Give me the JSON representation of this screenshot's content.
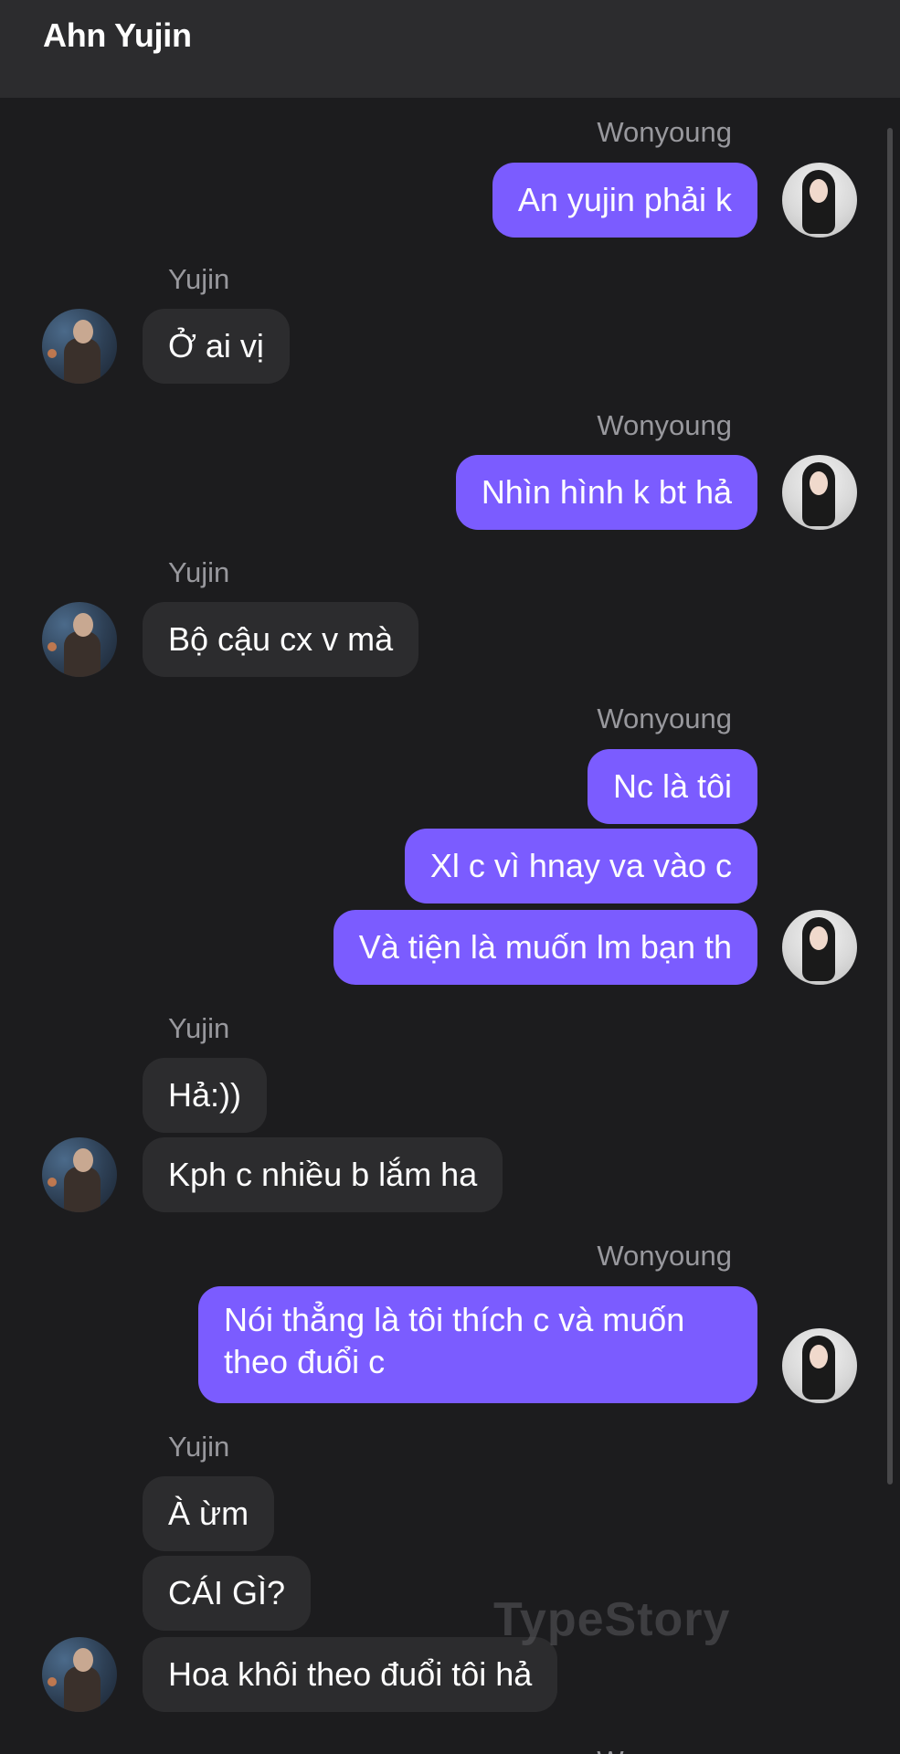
{
  "header": {
    "title": "Ahn Yujin"
  },
  "messages": [
    {
      "sender": "Wonyoung",
      "texts": [
        "An yujin phải k"
      ]
    },
    {
      "sender": "Yujin",
      "texts": [
        "Ở ai vị"
      ]
    },
    {
      "sender": "Wonyoung",
      "texts": [
        "Nhìn hình k bt hả"
      ]
    },
    {
      "sender": "Yujin",
      "texts": [
        "Bộ cậu cx v mà"
      ]
    },
    {
      "sender": "Wonyoung",
      "texts": [
        "Nc là tôi",
        "Xl c vì hnay va vào c",
        "Và tiện là muốn lm bạn th"
      ]
    },
    {
      "sender": "Yujin",
      "texts": [
        "Hả:))",
        "Kph c nhiều b lắm ha"
      ]
    },
    {
      "sender": "Wonyoung",
      "texts": [
        "Nói thẳng là tôi thích c và muốn theo đuổi c"
      ]
    },
    {
      "sender": "Yujin",
      "texts": [
        "À ừm",
        "CÁI GÌ?",
        "Hoa khôi theo đuổi tôi hả"
      ]
    },
    {
      "sender": "Wonyoung",
      "texts": []
    }
  ],
  "watermark": "TypeStory",
  "colors": {
    "outgoing_bubble": "#7b5cff",
    "incoming_bubble": "#2c2c2e",
    "background": "#1c1c1e",
    "header": "#2c2c2e"
  }
}
